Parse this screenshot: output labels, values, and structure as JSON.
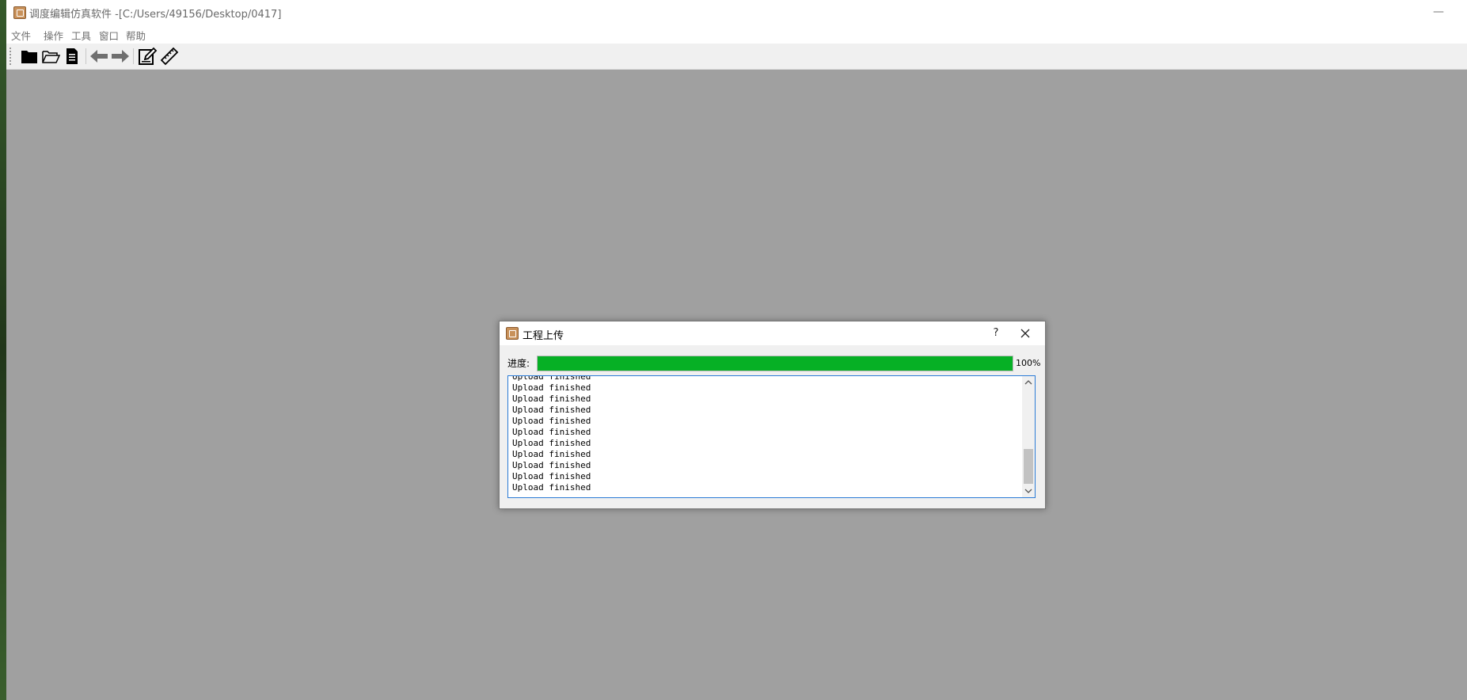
{
  "window": {
    "title": "调度编辑仿真软件 -[C:/Users/49156/Desktop/0417]",
    "minimize_glyph": "—"
  },
  "menu": {
    "items": [
      "文件",
      "操作",
      "工具",
      "窗口",
      "帮助"
    ]
  },
  "toolbar": {
    "buttons": [
      "folder-filled-icon",
      "folder-open-icon",
      "document-icon",
      "arrow-left-icon",
      "arrow-right-icon",
      "edit-icon",
      "ruler-icon"
    ]
  },
  "dialog": {
    "title": "工程上传",
    "help_label": "?",
    "progress_label": "进度:",
    "progress_value": 100,
    "progress_text": "100%",
    "log_lines": [
      "Upload finished",
      "Upload finished",
      "Upload finished",
      "Upload finished",
      "Upload finished",
      "Upload finished",
      "Upload finished",
      "Upload finished",
      "Upload finished",
      "Upload finished",
      "Upload finished"
    ],
    "colors": {
      "progress_fill": "#06b025",
      "log_border": "#2b7bd6"
    }
  }
}
